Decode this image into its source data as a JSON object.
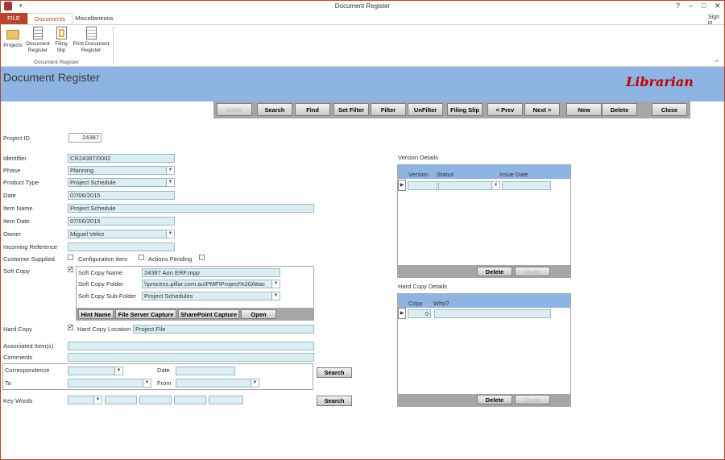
{
  "window": {
    "title": "Document Register",
    "help": "?",
    "minimize": "–",
    "maximize": "□",
    "close": "✕",
    "signin": "Sign in"
  },
  "ribbon": {
    "tabs": [
      "FILE",
      "Documents",
      "Miscellaneous"
    ],
    "buttons": [
      {
        "label1": "Projects",
        "label2": ""
      },
      {
        "label1": "Document",
        "label2": "Register"
      },
      {
        "label1": "Filing",
        "label2": "Slip"
      },
      {
        "label1": "Print Document",
        "label2": "Register"
      }
    ],
    "group_label": "Document Register",
    "collapse": "^"
  },
  "header": {
    "title": "Document Register",
    "logo": "Librarian"
  },
  "toolbar": [
    "Undo",
    "Search",
    "Find",
    "Set Filter",
    "Filter",
    "UnFilter",
    "Filing Slip",
    "< Prev",
    "Next >",
    "New",
    "Delete",
    "Close"
  ],
  "form": {
    "project_id_label": "Project ID",
    "project_id": "24387",
    "identifier_label": "Identifier",
    "identifier": "CR24387/0002",
    "phase_label": "Phase",
    "phase": "Planning",
    "product_type_label": "Product Type",
    "product_type": "Project Schedule",
    "date_label": "Date",
    "date": "07/06/2015",
    "item_name_label": "Item Name",
    "item_name": "Project Schedule",
    "item_date_label": "Item Date",
    "item_date": "07/06/2015",
    "owner_label": "Owner",
    "owner": "Miguel Velez",
    "incoming_ref_label": "Incoming Reference",
    "incoming_ref": "",
    "customer_supplied_label": "Customer Supplied",
    "config_item_label": "Configuration Item",
    "actions_pending_label": "Actions Pending",
    "soft_copy_label": "Soft Copy",
    "soft_copy_name_label": "Soft Copy Name",
    "soft_copy_name": "24387 Aon ERF.mpp",
    "soft_copy_folder_label": "Soft Copy Folder",
    "soft_copy_folder": "\\\\process.pillar.com.au\\PMF\\Project%20Attac",
    "soft_copy_subfolder_label": "Soft Copy Sub-Folder",
    "soft_copy_subfolder": "Project Schedules",
    "soft_buttons": [
      "Hint Name",
      "File Server Capture",
      "SharePoint Capture",
      "Open"
    ],
    "hard_copy_label": "Hard Copy",
    "hard_copy_location_label": "Hard Copy Location",
    "hard_copy_location": "Project File",
    "associated_label": "Associated Item(s)",
    "comments_label": "Comments",
    "correspondence_label": "Correspondence",
    "corr_date_label": "Date",
    "to_label": "To",
    "from_label": "From",
    "search_label": "Search",
    "keywords_label": "Key Words",
    "search2_label": "Search"
  },
  "version_details": {
    "title": "Version Details",
    "columns": [
      "Version",
      "Status",
      "Issue Date"
    ],
    "delete": "Delete",
    "undo": "Undo"
  },
  "hard_copy_details": {
    "title": "Hard Copy Details",
    "columns": [
      "Copy",
      "Who?"
    ],
    "copy_value": "0",
    "delete": "Delete",
    "undo": "Undo"
  }
}
